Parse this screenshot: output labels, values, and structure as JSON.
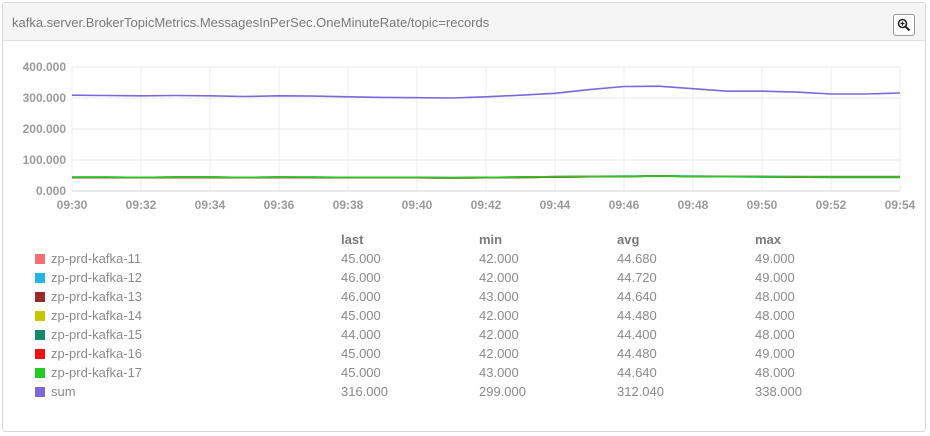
{
  "panel": {
    "title": "kafka.server.BrokerTopicMetrics.MessagesInPerSec.OneMinuteRate/topic=records",
    "zoom_icon": "zoom-in-icon"
  },
  "chart_data": {
    "type": "line",
    "x": [
      "09:30",
      "09:31",
      "09:32",
      "09:33",
      "09:34",
      "09:35",
      "09:36",
      "09:37",
      "09:38",
      "09:39",
      "09:40",
      "09:41",
      "09:42",
      "09:43",
      "09:44",
      "09:45",
      "09:46",
      "09:47",
      "09:48",
      "09:49",
      "09:50",
      "09:51",
      "09:52",
      "09:53",
      "09:54"
    ],
    "xticks": [
      "09:30",
      "09:32",
      "09:34",
      "09:36",
      "09:38",
      "09:40",
      "09:42",
      "09:44",
      "09:46",
      "09:48",
      "09:50",
      "09:52",
      "09:54"
    ],
    "ylim": [
      0,
      400
    ],
    "yticks": [
      0,
      100,
      200,
      300,
      400
    ],
    "ytick_labels": [
      "0.000",
      "100.000",
      "200.000",
      "300.000",
      "400.000"
    ],
    "grid": true,
    "series": [
      {
        "name": "zp-prd-kafka-11",
        "color": "#f07070",
        "values": [
          44,
          44,
          43,
          44,
          44,
          43,
          44,
          44,
          43,
          43,
          43,
          42,
          43,
          44,
          45,
          46,
          47,
          48,
          47,
          46,
          46,
          45,
          45,
          45,
          45
        ]
      },
      {
        "name": "zp-prd-kafka-12",
        "color": "#1fb6e6",
        "values": [
          45,
          45,
          44,
          45,
          45,
          44,
          45,
          45,
          44,
          44,
          44,
          43,
          44,
          45,
          46,
          47,
          48,
          49,
          48,
          47,
          47,
          46,
          46,
          46,
          46
        ]
      },
      {
        "name": "zp-prd-kafka-13",
        "color": "#9b2a2a",
        "values": [
          44,
          44,
          44,
          45,
          45,
          44,
          45,
          44,
          44,
          44,
          44,
          43,
          44,
          45,
          46,
          47,
          47,
          48,
          47,
          46,
          46,
          46,
          46,
          46,
          46
        ]
      },
      {
        "name": "zp-prd-kafka-14",
        "color": "#c8c800",
        "values": [
          44,
          44,
          43,
          44,
          44,
          43,
          44,
          44,
          43,
          43,
          43,
          42,
          43,
          44,
          45,
          46,
          47,
          48,
          47,
          46,
          46,
          45,
          45,
          45,
          45
        ]
      },
      {
        "name": "zp-prd-kafka-15",
        "color": "#138a6e",
        "values": [
          44,
          44,
          43,
          44,
          44,
          43,
          44,
          44,
          43,
          43,
          43,
          42,
          43,
          44,
          45,
          46,
          47,
          48,
          47,
          46,
          45,
          45,
          44,
          44,
          44
        ]
      },
      {
        "name": "zp-prd-kafka-16",
        "color": "#ee1111",
        "values": [
          44,
          44,
          43,
          44,
          44,
          43,
          44,
          44,
          43,
          43,
          43,
          42,
          43,
          44,
          45,
          46,
          47,
          48,
          47,
          46,
          46,
          45,
          45,
          45,
          45
        ]
      },
      {
        "name": "zp-prd-kafka-17",
        "color": "#22cc22",
        "values": [
          45,
          45,
          44,
          45,
          45,
          44,
          45,
          45,
          44,
          44,
          44,
          43,
          44,
          45,
          46,
          47,
          47,
          48,
          47,
          46,
          46,
          46,
          45,
          45,
          45
        ]
      },
      {
        "name": "sum",
        "color": "#7b68dd",
        "values": [
          309,
          308,
          307,
          308,
          307,
          305,
          307,
          306,
          304,
          302,
          301,
          300,
          304,
          309,
          315,
          327,
          337,
          338,
          330,
          322,
          322,
          319,
          313,
          313,
          316
        ]
      }
    ]
  },
  "legend": {
    "headers": {
      "last": "last",
      "min": "min",
      "avg": "avg",
      "max": "max"
    },
    "rows": [
      {
        "name": "zp-prd-kafka-11",
        "color": "#f07070",
        "last": "45.000",
        "min": "42.000",
        "avg": "44.680",
        "max": "49.000"
      },
      {
        "name": "zp-prd-kafka-12",
        "color": "#1fb6e6",
        "last": "46.000",
        "min": "42.000",
        "avg": "44.720",
        "max": "49.000"
      },
      {
        "name": "zp-prd-kafka-13",
        "color": "#9b2a2a",
        "last": "46.000",
        "min": "43.000",
        "avg": "44.640",
        "max": "48.000"
      },
      {
        "name": "zp-prd-kafka-14",
        "color": "#c8c800",
        "last": "45.000",
        "min": "42.000",
        "avg": "44.480",
        "max": "48.000"
      },
      {
        "name": "zp-prd-kafka-15",
        "color": "#138a6e",
        "last": "44.000",
        "min": "42.000",
        "avg": "44.400",
        "max": "48.000"
      },
      {
        "name": "zp-prd-kafka-16",
        "color": "#ee1111",
        "last": "45.000",
        "min": "42.000",
        "avg": "44.480",
        "max": "49.000"
      },
      {
        "name": "zp-prd-kafka-17",
        "color": "#22cc22",
        "last": "45.000",
        "min": "43.000",
        "avg": "44.640",
        "max": "48.000"
      },
      {
        "name": "sum",
        "color": "#7b68dd",
        "last": "316.000",
        "min": "299.000",
        "avg": "312.040",
        "max": "338.000"
      }
    ]
  }
}
